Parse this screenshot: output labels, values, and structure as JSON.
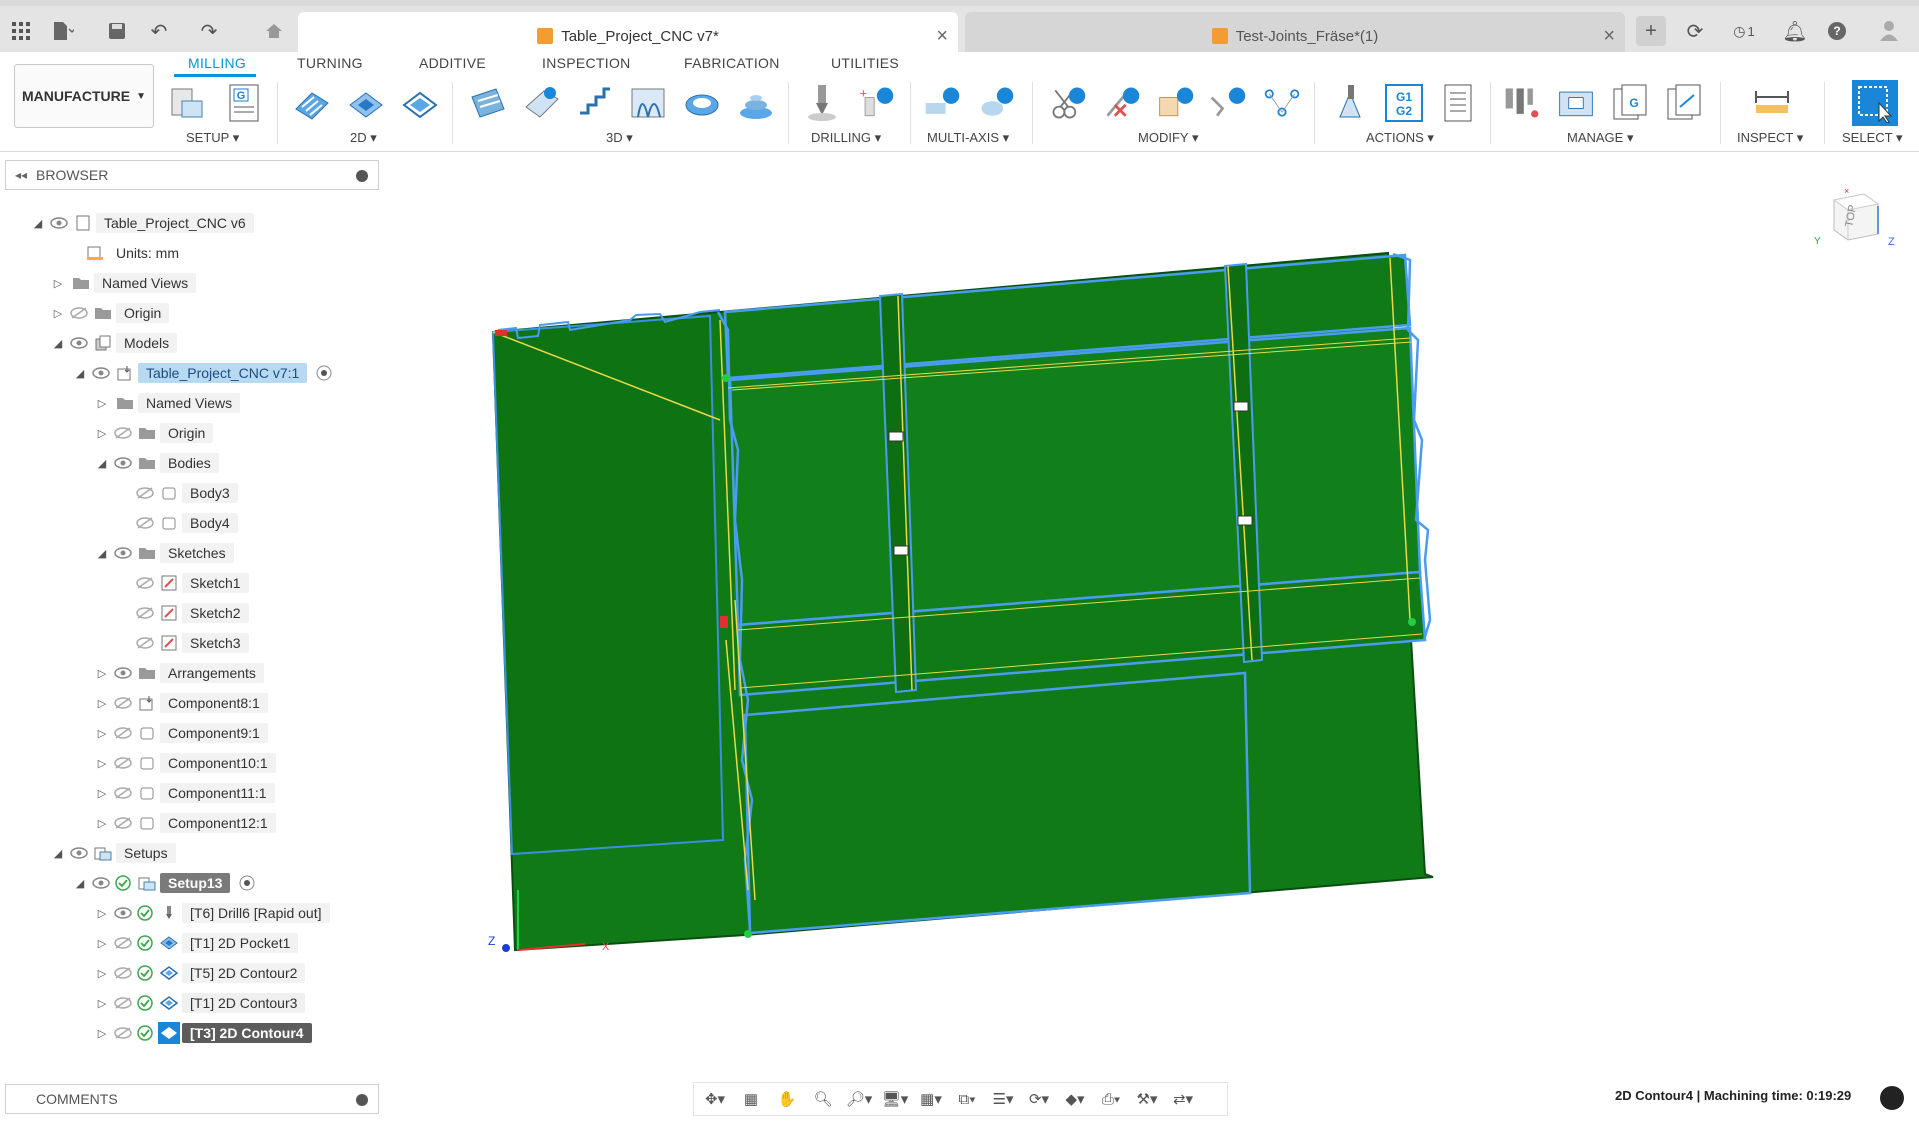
{
  "app": {
    "active_doc_tab": "Table_Project_CNC v7*",
    "other_doc_tab": "Test-Joints_Fräse*(1)",
    "notifications_count": "1"
  },
  "ribbon": {
    "workspace_button": "MANUFACTURE",
    "tabs": [
      "MILLING",
      "TURNING",
      "ADDITIVE",
      "INSPECTION",
      "FABRICATION",
      "UTILITIES"
    ],
    "groups": {
      "setup": "SETUP",
      "g2d": "2D",
      "g3d": "3D",
      "drilling": "DRILLING",
      "multiaxis": "MULTI-AXIS",
      "modify": "MODIFY",
      "actions": "ACTIONS",
      "manage": "MANAGE",
      "inspect": "INSPECT",
      "select": "SELECT"
    },
    "g1g2_text_top": "G1",
    "g1g2_text_bottom": "G2",
    "g_text": "G"
  },
  "browser": {
    "title": "BROWSER",
    "rows": [
      {
        "label": "Table_Project_CNC v6"
      },
      {
        "label": "Units: mm"
      },
      {
        "label": "Named Views"
      },
      {
        "label": "Origin"
      },
      {
        "label": "Models"
      },
      {
        "label": "Table_Project_CNC v7:1"
      },
      {
        "label": "Named Views"
      },
      {
        "label": "Origin"
      },
      {
        "label": "Bodies"
      },
      {
        "label": "Body3"
      },
      {
        "label": "Body4"
      },
      {
        "label": "Sketches"
      },
      {
        "label": "Sketch1"
      },
      {
        "label": "Sketch2"
      },
      {
        "label": "Sketch3"
      },
      {
        "label": "Arrangements"
      },
      {
        "label": "Component8:1"
      },
      {
        "label": "Component9:1"
      },
      {
        "label": "Component10:1"
      },
      {
        "label": "Component11:1"
      },
      {
        "label": "Component12:1"
      },
      {
        "label": "Setups"
      },
      {
        "label": "Setup13"
      },
      {
        "label": "[T6] Drill6 [Rapid out]"
      },
      {
        "label": "[T1] 2D Pocket1"
      },
      {
        "label": "[T5] 2D Contour2"
      },
      {
        "label": "[T1] 2D Contour3"
      },
      {
        "label": "[T3] 2D Contour4"
      }
    ]
  },
  "comments": {
    "title": "COMMENTS"
  },
  "status": {
    "text": "2D Contour4 | Machining time: 0:19:29"
  },
  "viewport": {
    "viewcube_label": "TOP",
    "axis_z": "Z",
    "axis_x": "X",
    "axis_y": "Y"
  },
  "colors": {
    "accent": "#0696d7",
    "body_green": "#0f7a16",
    "edge_blue": "#4a9cf0",
    "toolpath_yellow": "#e8d84a"
  }
}
